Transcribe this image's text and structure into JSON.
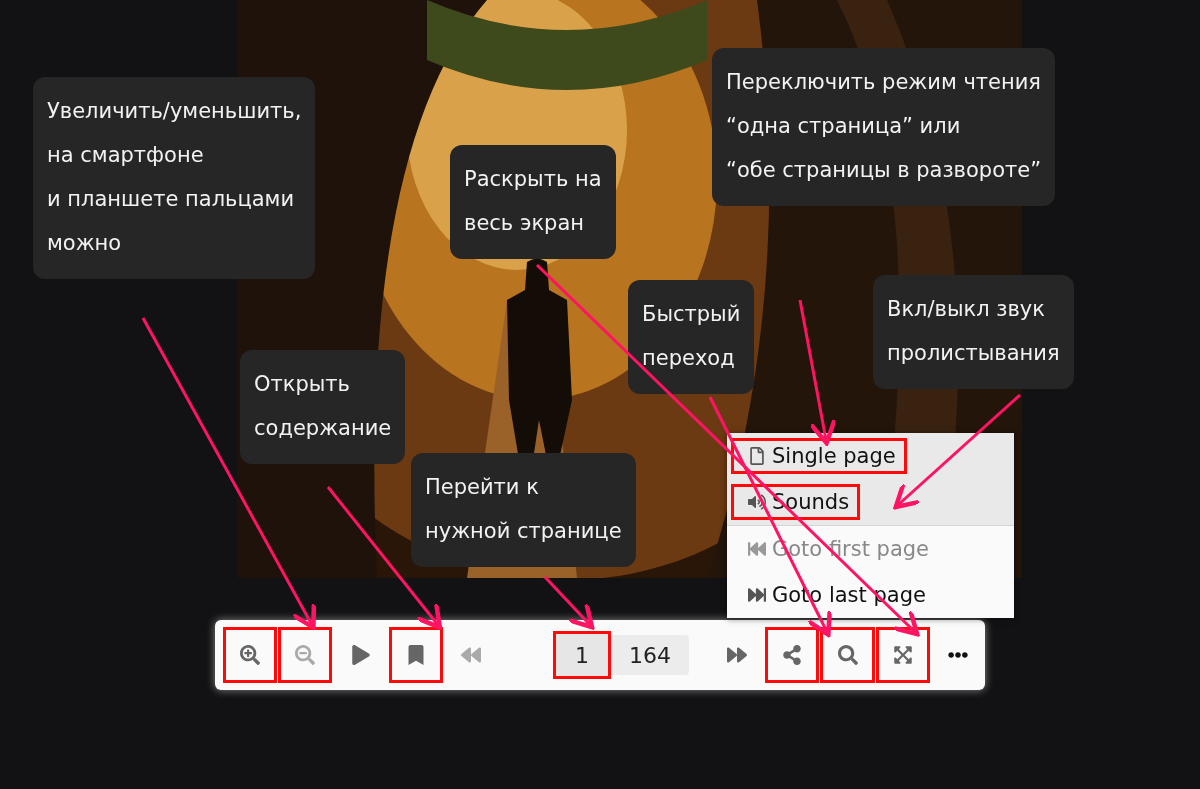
{
  "callouts": [
    {
      "text": "Переключить режим чтения\n“одна страница” или\n“обе страницы в развороте”"
    },
    {
      "text": "Увеличить/уменьшить,\nна смартфоне\nи планшете пальцами\nможно"
    },
    {
      "text": "Раскрыть на\nвесь экран"
    },
    {
      "text": "Быстрый\nпереход"
    },
    {
      "text": "Вкл/выкл звук\nпролистывания"
    },
    {
      "text": "Открыть\nсодержание"
    },
    {
      "text": "Перейти к\nнужной странице"
    }
  ],
  "menu": {
    "items": [
      {
        "kind": "single_page",
        "label": "Single page",
        "highlighted": true,
        "disabled": false,
        "marked": true
      },
      {
        "kind": "sounds",
        "label": "Sounds",
        "highlighted": true,
        "disabled": false,
        "marked": true
      },
      {
        "kind": "first_page",
        "label": "Goto first page",
        "highlighted": false,
        "disabled": true,
        "marked": false
      },
      {
        "kind": "last_page",
        "label": "Goto last page",
        "highlighted": false,
        "disabled": false,
        "marked": false
      }
    ]
  },
  "toolbar": {
    "items": [
      {
        "kind": "zoom_in",
        "disabled": false,
        "marked": true
      },
      {
        "kind": "zoom_out",
        "disabled": true,
        "marked": true
      },
      {
        "kind": "play",
        "disabled": false,
        "marked": false
      },
      {
        "kind": "contents",
        "disabled": false,
        "marked": true
      },
      {
        "kind": "prev",
        "disabled": true,
        "marked": false
      },
      {
        "kind": "page",
        "value": "1",
        "total": "164",
        "marked": true
      },
      {
        "kind": "next",
        "disabled": false,
        "marked": false
      },
      {
        "kind": "share",
        "disabled": false,
        "marked": true
      },
      {
        "kind": "search",
        "disabled": false,
        "marked": true
      },
      {
        "kind": "fullscreen",
        "disabled": false,
        "marked": true
      },
      {
        "kind": "more",
        "marked": false
      }
    ]
  }
}
